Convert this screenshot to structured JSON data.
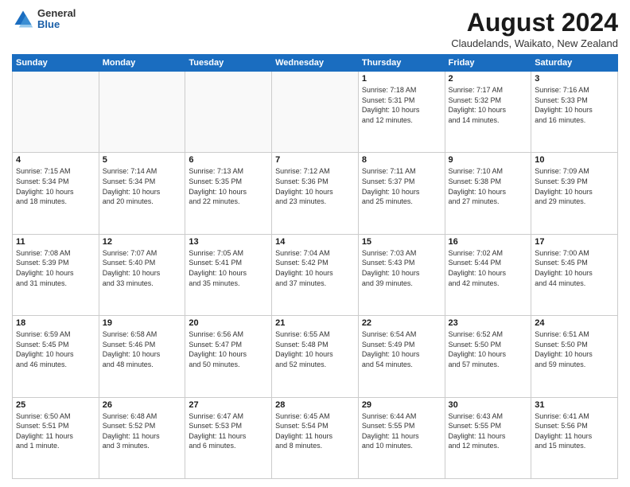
{
  "header": {
    "logo_general": "General",
    "logo_blue": "Blue",
    "title": "August 2024",
    "subtitle": "Claudelands, Waikato, New Zealand"
  },
  "days_of_week": [
    "Sunday",
    "Monday",
    "Tuesday",
    "Wednesday",
    "Thursday",
    "Friday",
    "Saturday"
  ],
  "weeks": [
    [
      {
        "day": "",
        "info": ""
      },
      {
        "day": "",
        "info": ""
      },
      {
        "day": "",
        "info": ""
      },
      {
        "day": "",
        "info": ""
      },
      {
        "day": "1",
        "info": "Sunrise: 7:18 AM\nSunset: 5:31 PM\nDaylight: 10 hours\nand 12 minutes."
      },
      {
        "day": "2",
        "info": "Sunrise: 7:17 AM\nSunset: 5:32 PM\nDaylight: 10 hours\nand 14 minutes."
      },
      {
        "day": "3",
        "info": "Sunrise: 7:16 AM\nSunset: 5:33 PM\nDaylight: 10 hours\nand 16 minutes."
      }
    ],
    [
      {
        "day": "4",
        "info": "Sunrise: 7:15 AM\nSunset: 5:34 PM\nDaylight: 10 hours\nand 18 minutes."
      },
      {
        "day": "5",
        "info": "Sunrise: 7:14 AM\nSunset: 5:34 PM\nDaylight: 10 hours\nand 20 minutes."
      },
      {
        "day": "6",
        "info": "Sunrise: 7:13 AM\nSunset: 5:35 PM\nDaylight: 10 hours\nand 22 minutes."
      },
      {
        "day": "7",
        "info": "Sunrise: 7:12 AM\nSunset: 5:36 PM\nDaylight: 10 hours\nand 23 minutes."
      },
      {
        "day": "8",
        "info": "Sunrise: 7:11 AM\nSunset: 5:37 PM\nDaylight: 10 hours\nand 25 minutes."
      },
      {
        "day": "9",
        "info": "Sunrise: 7:10 AM\nSunset: 5:38 PM\nDaylight: 10 hours\nand 27 minutes."
      },
      {
        "day": "10",
        "info": "Sunrise: 7:09 AM\nSunset: 5:39 PM\nDaylight: 10 hours\nand 29 minutes."
      }
    ],
    [
      {
        "day": "11",
        "info": "Sunrise: 7:08 AM\nSunset: 5:39 PM\nDaylight: 10 hours\nand 31 minutes."
      },
      {
        "day": "12",
        "info": "Sunrise: 7:07 AM\nSunset: 5:40 PM\nDaylight: 10 hours\nand 33 minutes."
      },
      {
        "day": "13",
        "info": "Sunrise: 7:05 AM\nSunset: 5:41 PM\nDaylight: 10 hours\nand 35 minutes."
      },
      {
        "day": "14",
        "info": "Sunrise: 7:04 AM\nSunset: 5:42 PM\nDaylight: 10 hours\nand 37 minutes."
      },
      {
        "day": "15",
        "info": "Sunrise: 7:03 AM\nSunset: 5:43 PM\nDaylight: 10 hours\nand 39 minutes."
      },
      {
        "day": "16",
        "info": "Sunrise: 7:02 AM\nSunset: 5:44 PM\nDaylight: 10 hours\nand 42 minutes."
      },
      {
        "day": "17",
        "info": "Sunrise: 7:00 AM\nSunset: 5:45 PM\nDaylight: 10 hours\nand 44 minutes."
      }
    ],
    [
      {
        "day": "18",
        "info": "Sunrise: 6:59 AM\nSunset: 5:45 PM\nDaylight: 10 hours\nand 46 minutes."
      },
      {
        "day": "19",
        "info": "Sunrise: 6:58 AM\nSunset: 5:46 PM\nDaylight: 10 hours\nand 48 minutes."
      },
      {
        "day": "20",
        "info": "Sunrise: 6:56 AM\nSunset: 5:47 PM\nDaylight: 10 hours\nand 50 minutes."
      },
      {
        "day": "21",
        "info": "Sunrise: 6:55 AM\nSunset: 5:48 PM\nDaylight: 10 hours\nand 52 minutes."
      },
      {
        "day": "22",
        "info": "Sunrise: 6:54 AM\nSunset: 5:49 PM\nDaylight: 10 hours\nand 54 minutes."
      },
      {
        "day": "23",
        "info": "Sunrise: 6:52 AM\nSunset: 5:50 PM\nDaylight: 10 hours\nand 57 minutes."
      },
      {
        "day": "24",
        "info": "Sunrise: 6:51 AM\nSunset: 5:50 PM\nDaylight: 10 hours\nand 59 minutes."
      }
    ],
    [
      {
        "day": "25",
        "info": "Sunrise: 6:50 AM\nSunset: 5:51 PM\nDaylight: 11 hours\nand 1 minute."
      },
      {
        "day": "26",
        "info": "Sunrise: 6:48 AM\nSunset: 5:52 PM\nDaylight: 11 hours\nand 3 minutes."
      },
      {
        "day": "27",
        "info": "Sunrise: 6:47 AM\nSunset: 5:53 PM\nDaylight: 11 hours\nand 6 minutes."
      },
      {
        "day": "28",
        "info": "Sunrise: 6:45 AM\nSunset: 5:54 PM\nDaylight: 11 hours\nand 8 minutes."
      },
      {
        "day": "29",
        "info": "Sunrise: 6:44 AM\nSunset: 5:55 PM\nDaylight: 11 hours\nand 10 minutes."
      },
      {
        "day": "30",
        "info": "Sunrise: 6:43 AM\nSunset: 5:55 PM\nDaylight: 11 hours\nand 12 minutes."
      },
      {
        "day": "31",
        "info": "Sunrise: 6:41 AM\nSunset: 5:56 PM\nDaylight: 11 hours\nand 15 minutes."
      }
    ]
  ]
}
